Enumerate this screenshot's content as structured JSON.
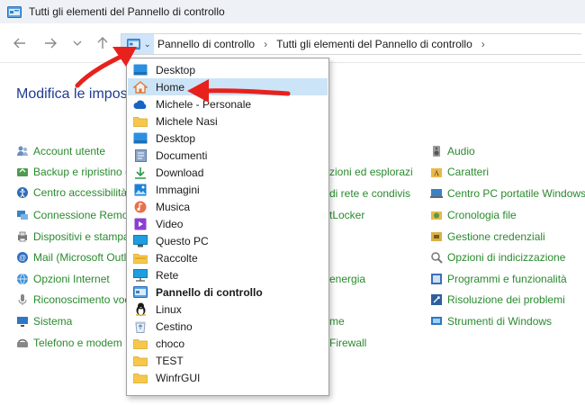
{
  "window": {
    "title": "Tutti gli elementi del Pannello di controllo"
  },
  "breadcrumb": {
    "items": [
      "Pannello di controllo",
      "Tutti gli elementi del Pannello di controllo"
    ]
  },
  "main": {
    "heading": "Modifica le impost"
  },
  "left_column": [
    "Account utente",
    "Backup e ripristino (W",
    "Centro accessibilità",
    "Connessione Remote",
    "Dispositivi e stampa",
    "Mail (Microsoft Outl",
    "Opzioni Internet",
    "Riconoscimento voc",
    "Sistema",
    "Telefono e modem"
  ],
  "middle_column": [
    "zioni ed esplorazi",
    "di rete e condivis",
    "tLocker",
    "energia",
    "me",
    "Firewall"
  ],
  "right_column": [
    "Audio",
    "Caratteri",
    "Centro PC portatile Windows",
    "Cronologia file",
    "Gestione credenziali",
    "Opzioni di indicizzazione",
    "Programmi e funzionalità",
    "Risoluzione dei problemi",
    "Strumenti di Windows"
  ],
  "dropdown": {
    "items": [
      {
        "label": "Desktop",
        "icon": "desktop-icon"
      },
      {
        "label": "Home",
        "icon": "home-icon",
        "selected": true
      },
      {
        "label": "Michele - Personale",
        "icon": "onedrive-cloud-icon"
      },
      {
        "label": "Michele Nasi",
        "icon": "user-folder-icon"
      },
      {
        "label": "Desktop",
        "icon": "desktop-folder-icon"
      },
      {
        "label": "Documenti",
        "icon": "documents-icon"
      },
      {
        "label": "Download",
        "icon": "download-icon"
      },
      {
        "label": "Immagini",
        "icon": "pictures-icon"
      },
      {
        "label": "Musica",
        "icon": "music-icon"
      },
      {
        "label": "Video",
        "icon": "video-icon"
      },
      {
        "label": "Questo PC",
        "icon": "this-pc-icon"
      },
      {
        "label": "Raccolte",
        "icon": "libraries-icon"
      },
      {
        "label": "Rete",
        "icon": "network-icon"
      },
      {
        "label": "Pannello di controllo",
        "icon": "control-panel-icon",
        "bold": true
      },
      {
        "label": "Linux",
        "icon": "linux-penguin-icon"
      },
      {
        "label": "Cestino",
        "icon": "recycle-bin-icon"
      },
      {
        "label": "choco",
        "icon": "folder-icon"
      },
      {
        "label": "TEST",
        "icon": "folder-icon"
      },
      {
        "label": "WinfrGUI",
        "icon": "folder-icon"
      }
    ]
  },
  "colors": {
    "link_green": "#2a8a2e",
    "heading_blue": "#1e3d8f",
    "selection": "#cce4f7",
    "arrow_red": "#e8211c"
  }
}
